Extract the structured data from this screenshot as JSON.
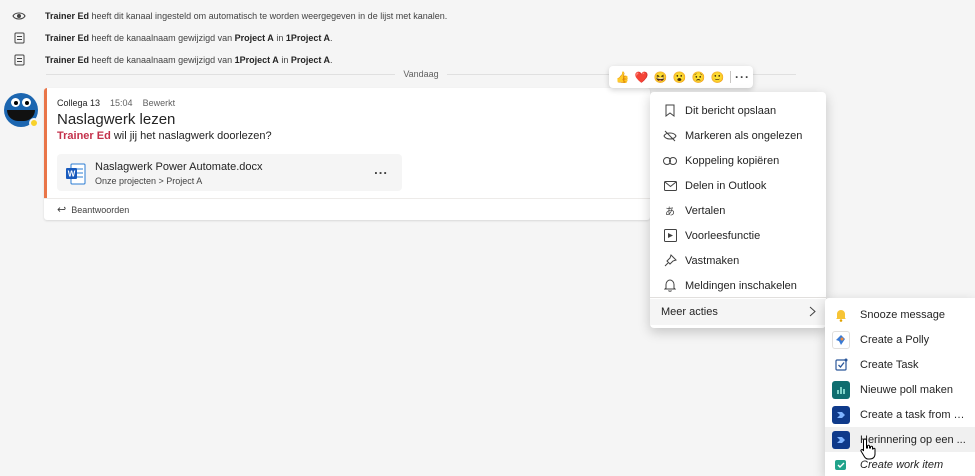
{
  "system_messages": [
    {
      "icon": "eye-icon",
      "actor": "Trainer Ed",
      "text": " heeft dit kanaal ingesteld om automatisch te worden weergegeven in de lijst met kanalen."
    },
    {
      "icon": "document-icon",
      "actor": "Trainer Ed",
      "text": " heeft de kanaalnaam gewijzigd van ",
      "from": "Project A",
      "mid": " in ",
      "to": "1Project A",
      "end": "."
    },
    {
      "icon": "document-icon",
      "actor": "Trainer Ed",
      "text": " heeft de kanaalnaam gewijzigd van ",
      "from": "1Project A",
      "mid": " in ",
      "to": "Project A",
      "end": "."
    }
  ],
  "day_divider": "Vandaag",
  "message": {
    "author": "Collega 13",
    "time": "15:04",
    "edited": "Bewerkt",
    "subject": "Naslagwerk lezen",
    "mention": "Trainer Ed",
    "body": " wil jij het naslagwerk doorlezen?",
    "file": {
      "name": "Naslagwerk Power Automate.docx",
      "path": "Onze projecten > Project A",
      "more": "..."
    },
    "reply_label": "Beantwoorden"
  },
  "reactions": [
    "👍",
    "❤️",
    "😆",
    "😮",
    "😟",
    "🙂"
  ],
  "reaction_more": "···",
  "context_menu": {
    "items": [
      {
        "icon": "bookmark-icon",
        "label": "Dit bericht opslaan"
      },
      {
        "icon": "mark-unread-icon",
        "label": "Markeren als ongelezen"
      },
      {
        "icon": "link-icon",
        "label": "Koppeling kopiëren"
      },
      {
        "icon": "mail-icon",
        "label": "Delen in Outlook"
      },
      {
        "icon": "translate-icon",
        "label": "Vertalen"
      },
      {
        "icon": "immersive-reader-icon",
        "label": "Voorleesfunctie"
      },
      {
        "icon": "pin-icon",
        "label": "Vastmaken"
      },
      {
        "icon": "bell-icon",
        "label": "Meldingen inschakelen"
      }
    ],
    "more_actions": "Meer acties"
  },
  "sub_menu": {
    "items": [
      {
        "icon": "snooze-bell-icon",
        "label": "Snooze message",
        "color": "#f7c435"
      },
      {
        "icon": "polly-icon",
        "label": "Create a Polly",
        "color": "#ffffff"
      },
      {
        "icon": "task-icon",
        "label": "Create Task",
        "color": "#ffffff"
      },
      {
        "icon": "poll-icon",
        "label": "Nieuwe poll maken",
        "color": "#0f6d6f"
      },
      {
        "icon": "power-automate-icon",
        "label": "Create a task from a...",
        "color": "#0f3a8a"
      },
      {
        "icon": "power-automate-icon",
        "label": "Herinnering op een ...",
        "color": "#0f3a8a"
      },
      {
        "icon": "work-item-icon",
        "label": "Create work item",
        "color": "#ffffff"
      }
    ]
  },
  "colors": {
    "accent": "#e97548",
    "mention": "#c4314b",
    "teams_purple": "#6264a7"
  }
}
